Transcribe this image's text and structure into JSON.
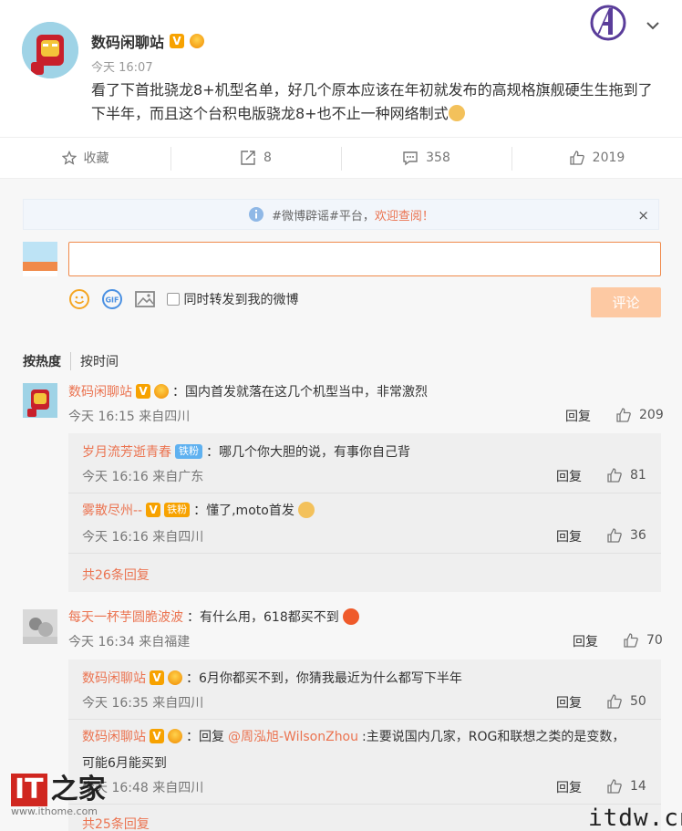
{
  "post": {
    "author": "数码闲聊站",
    "time": "今天 16:07",
    "text": "看了下首批骁龙8+机型名单，好几个原本应该在年初就发布的高规格旗舰硬生生拖到了下半年，而且这个台积电版骁龙8+也不止一种网络制式"
  },
  "actions": {
    "favorite": "收藏",
    "repost": "8",
    "comment": "358",
    "like": "2019"
  },
  "notice": {
    "prefix": "#微博辟谣#平台，",
    "link": "欢迎查阅！",
    "close": "×"
  },
  "composer": {
    "repost_label": "同时转发到我的微博",
    "submit": "评论"
  },
  "sort": {
    "hot": "按热度",
    "time": "按时间"
  },
  "comments": [
    {
      "name": "数码闲聊站",
      "text": "：国内首发就落在这几个机型当中，非常激烈",
      "meta": "今天 16:15 来自四川",
      "reply": "回复",
      "likes": "209",
      "subs": [
        {
          "name": "岁月流芳逝青春",
          "badge": "铁粉",
          "text": "：哪几个你大胆的说，有事你自己背",
          "meta": "今天 16:16 来自广东",
          "reply": "回复",
          "likes": "81"
        },
        {
          "name": "雾散尽州--",
          "badge": "铁粉",
          "text": "：懂了,moto首发",
          "meta": "今天 16:16 来自四川",
          "reply": "回复",
          "likes": "36"
        }
      ],
      "more": "共26条回复"
    },
    {
      "name": "每天一杯芋圆脆波波",
      "text": "：有什么用，618都买不到",
      "meta": "今天 16:34 来自福建",
      "reply": "回复",
      "likes": "70",
      "subs": [
        {
          "name": "数码闲聊站",
          "text": "：6月你都买不到，你猜我最近为什么都写下半年",
          "meta": "今天 16:35 来自四川",
          "reply": "回复",
          "likes": "50"
        },
        {
          "name": "数码闲聊站",
          "text_prefix": "：回复",
          "mention": "@周泓旭-WilsonZhou",
          "text": ":主要说国内几家，ROG和联想之类的是变数，",
          "text2": "可能6月能买到",
          "meta": "今天 16:48 来自四川",
          "reply": "回复",
          "likes": "14"
        }
      ],
      "more": "共25条回复"
    }
  ],
  "watermarks": {
    "it": "IT",
    "zhi": "之家",
    "url": "www.ithome.com",
    "itdw": "itdw.cn"
  }
}
